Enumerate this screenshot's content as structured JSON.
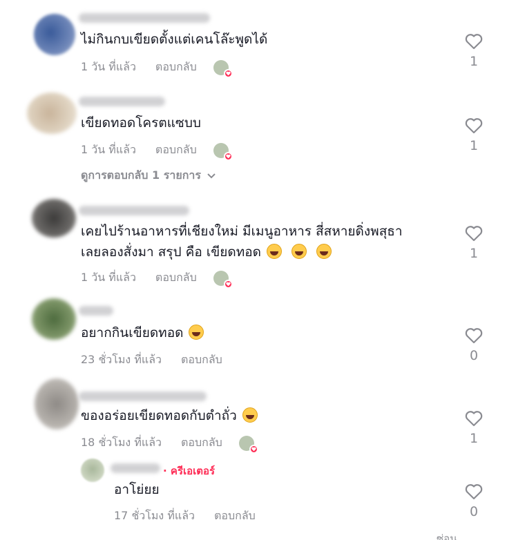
{
  "comments": [
    {
      "text": "ไม่กินกบเขียดตั้งแต่เคนโล๊ะพูดได้",
      "time": "1 วัน ที่แล้ว",
      "reply_label": "ตอบกลับ",
      "likes": "1"
    },
    {
      "text": "เขียดทอดโครตแซบบ",
      "time": "1 วัน ที่แล้ว",
      "reply_label": "ตอบกลับ",
      "likes": "1",
      "view_replies": "ดูการตอบกลับ 1 รายการ"
    },
    {
      "text_line1": "เคยไปร้านอาหารที่เชียงใหม่ มีเมนูอาหาร สี่สหายดิ่งพสุธา",
      "text_line2": "เลยลองสั่งมา สรุป คือ เขียดทอด",
      "emoji": "rolling-on-floor-laughing x3",
      "time": "1 วัน ที่แล้ว",
      "reply_label": "ตอบกลับ",
      "likes": "1"
    },
    {
      "text": "อยากกินเขียดทอด",
      "emoji": "grinning-face",
      "time": "23 ชั่วโมง ที่แล้ว",
      "reply_label": "ตอบกลับ",
      "likes": "0"
    },
    {
      "text": "ของอร่อยเขียดทอดกับตำถั่ว",
      "emoji": "tears-of-joy",
      "time": "18 ชั่วโมง ที่แล้ว",
      "reply_label": "ตอบกลับ",
      "likes": "1"
    }
  ],
  "reply": {
    "creator_badge": "· ครีเอเตอร์",
    "text": "อาโย่ยย",
    "time": "17 ชั่วโมง ที่แล้ว",
    "reply_label": "ตอบกลับ",
    "likes": "0"
  },
  "footer_partial": "ซ่อน",
  "colors": {
    "accent": "#fe2c55",
    "meta_text": "#8a8b91",
    "body_text": "#161823"
  },
  "icons": [
    "heart-outline-icon",
    "chevron-down-icon",
    "creator-liked-heart-icon"
  ]
}
